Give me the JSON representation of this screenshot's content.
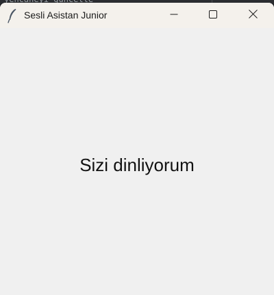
{
  "background": {
    "text": "yencaneyi_guncelle"
  },
  "window": {
    "title": "Sesli Asistan Junior",
    "icon": "feather-icon",
    "controls": {
      "minimize_icon": "minimize-icon",
      "maximize_icon": "maximize-icon",
      "close_icon": "close-icon"
    }
  },
  "main": {
    "status_text": "Sizi dinliyorum"
  },
  "colors": {
    "window_background": "#f0f0f0",
    "titlebar_background": "#f4f1ec",
    "text": "#111111"
  }
}
